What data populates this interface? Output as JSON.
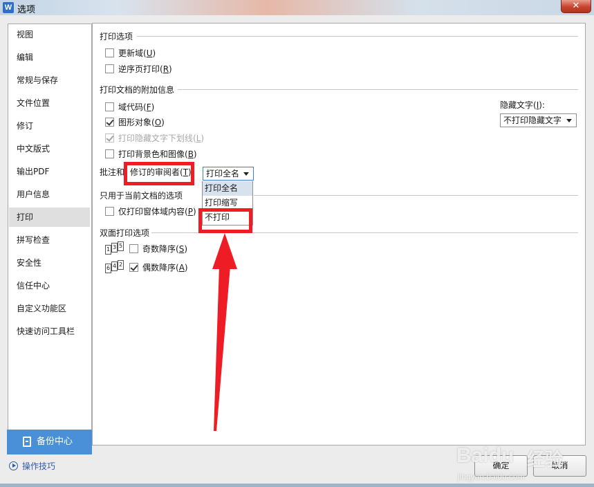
{
  "window": {
    "title": "选项",
    "app_icon_letter": "W",
    "close_glyph": "✕"
  },
  "sidebar": {
    "items": [
      {
        "label": "视图"
      },
      {
        "label": "编辑"
      },
      {
        "label": "常规与保存"
      },
      {
        "label": "文件位置"
      },
      {
        "label": "修订"
      },
      {
        "label": "中文版式"
      },
      {
        "label": "输出PDF"
      },
      {
        "label": "用户信息"
      },
      {
        "label": "打印",
        "selected": true
      },
      {
        "label": "拼写检查"
      },
      {
        "label": "安全性"
      },
      {
        "label": "信任中心"
      },
      {
        "label": "自定义功能区"
      },
      {
        "label": "快速访问工具栏"
      }
    ],
    "backup_label": "备份中心",
    "tips_label": "操作技巧"
  },
  "print_options": {
    "heading": "打印选项",
    "update_fields": {
      "text": "更新域(",
      "key": "U",
      "end": ")",
      "checked": false
    },
    "reverse_order": {
      "text": "逆序页打印(",
      "key": "R",
      "end": ")",
      "checked": false
    }
  },
  "extra_info": {
    "heading": "打印文档的附加信息",
    "field_codes": {
      "text": "域代码(",
      "key": "F",
      "end": ")",
      "checked": false
    },
    "drawing_objects": {
      "text": "图形对象(",
      "key": "O",
      "end": ")",
      "checked": true
    },
    "hidden_underline": {
      "text": "打印隐藏文字下划线(",
      "key": "L",
      "end": ")",
      "checked": true,
      "disabled": true
    },
    "background": {
      "text": "打印背景色和图像(",
      "key": "B",
      "end": ")",
      "checked": false
    },
    "hidden_text_label": {
      "text": "隐藏文字(",
      "key": "I",
      "end": "):"
    },
    "hidden_text_value": "不打印隐藏文字",
    "comment_label": "批注和",
    "reviewer_label": {
      "text": "修订的审阅者(",
      "key": "T",
      "end": ")"
    },
    "reviewer_value": "打印全名",
    "reviewer_options": [
      "打印全名",
      "打印缩写",
      "不打印"
    ]
  },
  "current_doc": {
    "heading": "只用于当前文档的选项",
    "form_only": {
      "text": "仅打印窗体域内容(",
      "key": "P",
      "end": ")",
      "checked": false
    }
  },
  "duplex": {
    "heading": "双面打印选项",
    "odd": {
      "text": "奇数降序(",
      "key": "S",
      "end": ")",
      "checked": false,
      "pages": [
        "1",
        "3",
        "5"
      ]
    },
    "even": {
      "text": "偶数降序(",
      "key": "A",
      "end": ")",
      "checked": true,
      "pages": [
        "6",
        "4",
        "2"
      ]
    }
  },
  "buttons": {
    "ok": "确定",
    "cancel": "取消"
  },
  "watermark": {
    "brand": "Bai",
    "brand_tail": "du",
    "suffix": "经验",
    "url": "jingyan.baidu.com"
  },
  "colors": {
    "accent": "#4a90d9",
    "annotation_red": "#ee1c24",
    "selection": "#d8e2ee"
  }
}
